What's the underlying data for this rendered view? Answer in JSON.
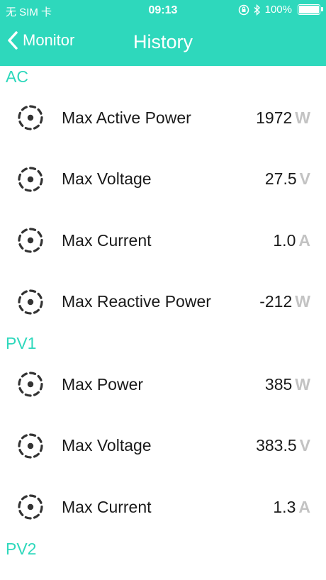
{
  "status_bar": {
    "carrier": "无 SIM 卡",
    "time": "09:13",
    "battery": "100%"
  },
  "nav": {
    "back_label": "Monitor",
    "title": "History"
  },
  "sections": [
    {
      "title": "AC",
      "rows": [
        {
          "label": "Max Active Power",
          "value": "1972",
          "unit": "W"
        },
        {
          "label": "Max Voltage",
          "value": "27.5",
          "unit": "V"
        },
        {
          "label": "Max Current",
          "value": "1.0",
          "unit": "A"
        },
        {
          "label": "Max Reactive Power",
          "value": "-212",
          "unit": "W"
        }
      ]
    },
    {
      "title": "PV1",
      "rows": [
        {
          "label": "Max Power",
          "value": "385",
          "unit": "W"
        },
        {
          "label": "Max Voltage",
          "value": "383.5",
          "unit": "V"
        },
        {
          "label": "Max Current",
          "value": "1.3",
          "unit": "A"
        }
      ]
    },
    {
      "title": "PV2",
      "rows": []
    }
  ],
  "colors": {
    "accent": "#2ed8bc",
    "unit": "#c3c3c3"
  }
}
